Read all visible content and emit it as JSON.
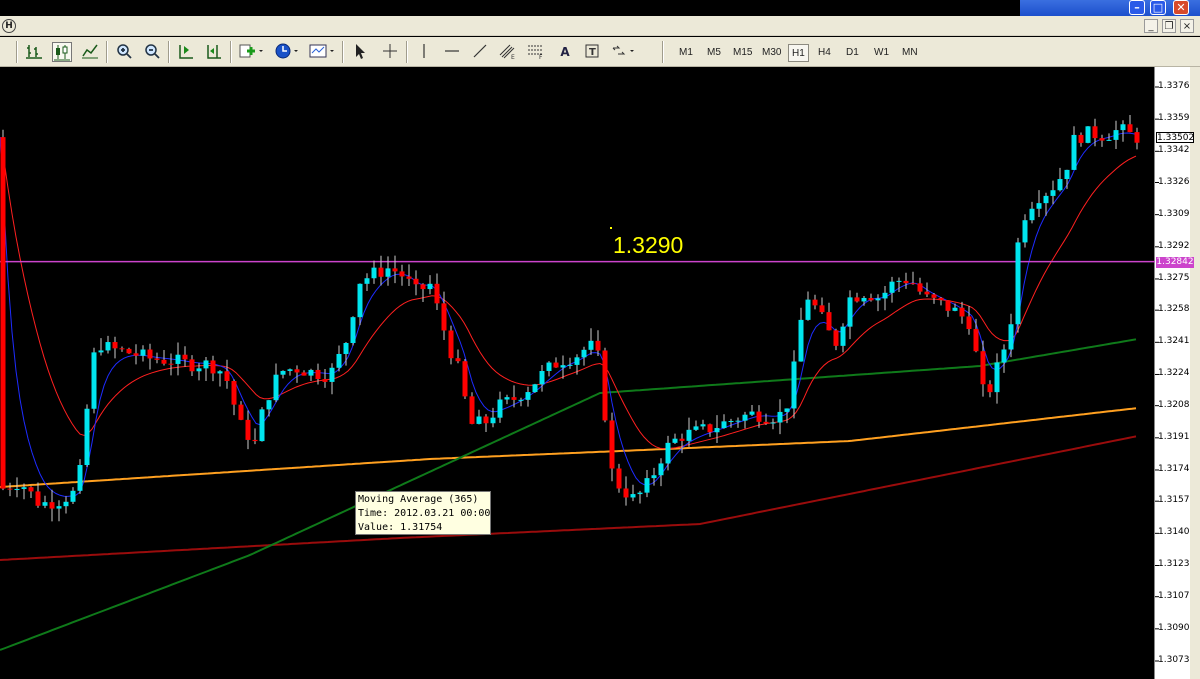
{
  "window": {
    "min_glyph": "–",
    "max_glyph": "□",
    "close_glyph": "✕",
    "menu_icon": "H"
  },
  "toolbar": {
    "timeframes": [
      "M1",
      "M5",
      "M15",
      "M30",
      "H1",
      "H4",
      "D1",
      "W1",
      "MN"
    ],
    "active_timeframe": "H1",
    "tool_text_label": "A"
  },
  "chart": {
    "horizontal_line_label": "1.3290",
    "current_price": "1.33502",
    "hline_price": "1.32842",
    "axis_ticks": [
      "1.33765",
      "1.33595",
      "1.33425",
      "1.33260",
      "1.33090",
      "1.32920",
      "1.32750",
      "1.32585",
      "1.32415",
      "1.32245",
      "1.32080",
      "1.31910",
      "1.31740",
      "1.31575",
      "1.31405",
      "1.31235",
      "1.31070",
      "1.30900",
      "1.30730"
    ],
    "tooltip": {
      "line1": "Moving Average (365)",
      "line2": "Time: 2012.03.21 00:00",
      "line3": "Value: 1.31754"
    },
    "colors": {
      "bull": "#00e5ee",
      "bear": "#ff0000",
      "ma_fast": "#1e2cff",
      "ma_mid": "#ff2020",
      "ma_green": "#0f7a1a",
      "ma_orange": "#ffa020",
      "ma_dark": "#9a0c0c",
      "hline": "#cc44cc"
    }
  }
}
